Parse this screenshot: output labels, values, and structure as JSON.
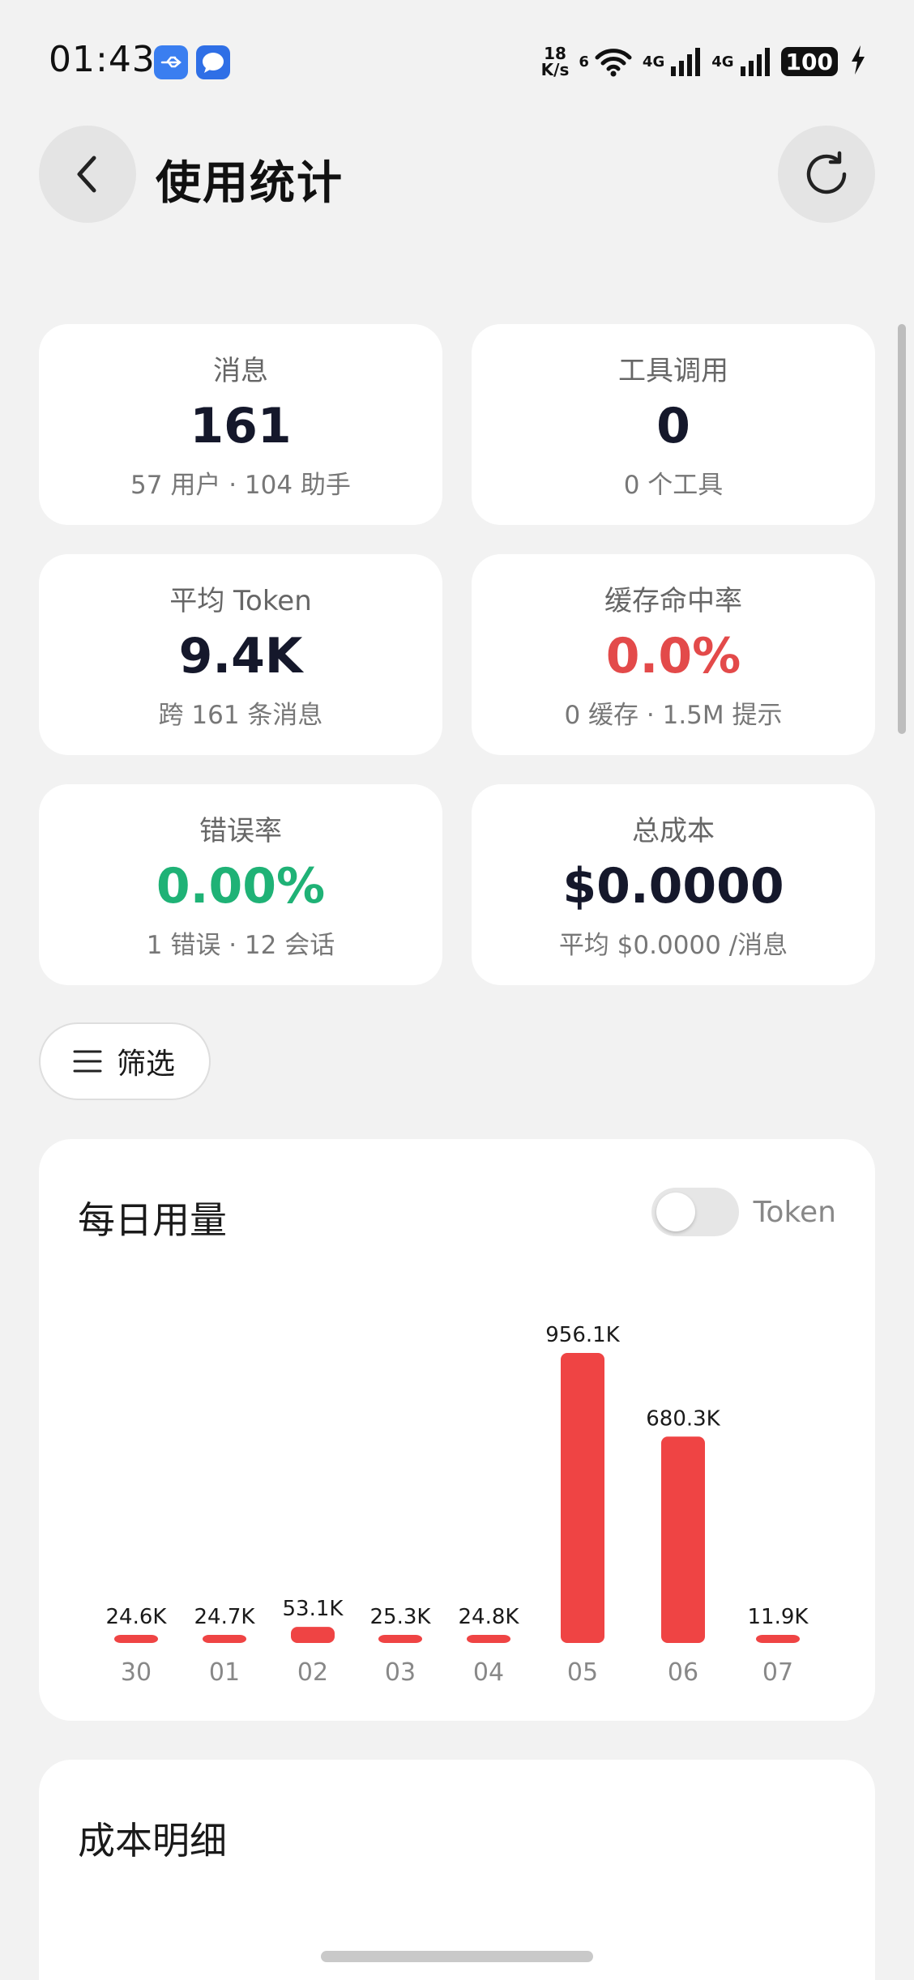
{
  "status_bar": {
    "time": "01:43",
    "net_speed_value": "18",
    "net_speed_unit": "K/s",
    "wifi_label": "6",
    "signal_1_label": "4G",
    "signal_2_label": "4G",
    "battery_level": "100",
    "icons": [
      "usb-icon",
      "message-icon",
      "wifi-icon",
      "signal-icon",
      "battery-icon",
      "charging-icon"
    ]
  },
  "header": {
    "title": "使用统计",
    "back_icon": "chevron-left-icon",
    "refresh_icon": "refresh-icon"
  },
  "stats": [
    {
      "label": "消息",
      "value": "161",
      "sub": "57 用户 · 104 助手",
      "tone": "normal"
    },
    {
      "label": "工具调用",
      "value": "0",
      "sub": "0 个工具",
      "tone": "normal"
    },
    {
      "label": "平均 Token",
      "value": "9.4K",
      "sub": "跨 161 条消息",
      "tone": "normal"
    },
    {
      "label": "缓存命中率",
      "value": "0.0%",
      "sub": "0 缓存 · 1.5M 提示",
      "tone": "red"
    },
    {
      "label": "错误率",
      "value": "0.00%",
      "sub": "1 错误 · 12 会话",
      "tone": "green"
    },
    {
      "label": "总成本",
      "value": "$0.0000",
      "sub": "平均 $0.0000 /消息",
      "tone": "normal"
    }
  ],
  "filter": {
    "label": "筛选",
    "icon": "menu-icon"
  },
  "daily_usage": {
    "title": "每日用量",
    "toggle_label": "Token",
    "toggle_on": false
  },
  "chart_data": {
    "type": "bar",
    "title": "每日用量",
    "categories": [
      "30",
      "01",
      "02",
      "03",
      "04",
      "05",
      "06",
      "07"
    ],
    "values": [
      24.6,
      24.7,
      53.1,
      25.3,
      24.8,
      956.1,
      680.3,
      11.9
    ],
    "value_unit": "K",
    "data_labels": [
      "24.6K",
      "24.7K",
      "53.1K",
      "25.3K",
      "24.8K",
      "956.1K",
      "680.3K",
      "11.9K"
    ],
    "ylim": [
      0,
      956.1
    ],
    "bar_color": "#ef4444",
    "grid": false
  },
  "cost_detail": {
    "title": "成本明细"
  },
  "colors": {
    "accent_red": "#e34a4a",
    "accent_green": "#1fb276",
    "bar": "#ef4444"
  }
}
